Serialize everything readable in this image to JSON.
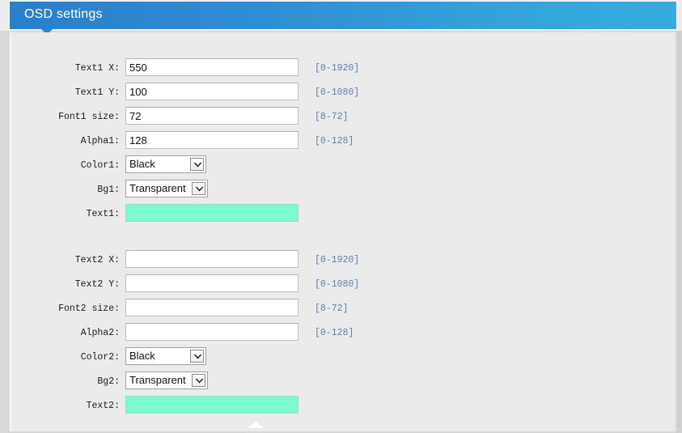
{
  "window": {
    "title": "OSD settings"
  },
  "theme": {
    "header_gradient_start": "#2a7fc9",
    "header_gradient_end": "#36abde",
    "panel_bg": "#ebebeb",
    "hint_color": "#5b7faa",
    "autofill_bg": "#7dfbd0"
  },
  "sections": [
    {
      "id": "text1",
      "rows": [
        {
          "label": "Text1 X:",
          "type": "text",
          "value": "550",
          "hint": "[0-1920]"
        },
        {
          "label": "Text1 Y:",
          "type": "text",
          "value": "100",
          "hint": "[0-1080]"
        },
        {
          "label": "Font1 size:",
          "type": "text",
          "value": "72",
          "hint": "[8-72]"
        },
        {
          "label": "Alpha1:",
          "type": "text",
          "value": "128",
          "hint": "[0-128]"
        },
        {
          "label": "Color1:",
          "type": "select",
          "value": "Black",
          "hint": ""
        },
        {
          "label": "Bg1:",
          "type": "select",
          "value": "Transparent",
          "hint": ""
        },
        {
          "label": "Text1:",
          "type": "text",
          "value": "",
          "hint": "",
          "autofill": true
        }
      ]
    },
    {
      "id": "text2",
      "rows": [
        {
          "label": "Text2 X:",
          "type": "text",
          "value": "",
          "hint": "[0-1920]"
        },
        {
          "label": "Text2 Y:",
          "type": "text",
          "value": "",
          "hint": "[0-1080]"
        },
        {
          "label": "Font2 size:",
          "type": "text",
          "value": "",
          "hint": "[8-72]"
        },
        {
          "label": "Alpha2:",
          "type": "text",
          "value": "",
          "hint": "[0-128]"
        },
        {
          "label": "Color2:",
          "type": "select",
          "value": "Black",
          "hint": ""
        },
        {
          "label": "Bg2:",
          "type": "select",
          "value": "Transparent",
          "hint": ""
        },
        {
          "label": "Text2:",
          "type": "text",
          "value": "",
          "hint": "",
          "autofill": true
        }
      ]
    }
  ],
  "footer": {
    "collapse_icon": "triangle-up-icon"
  }
}
